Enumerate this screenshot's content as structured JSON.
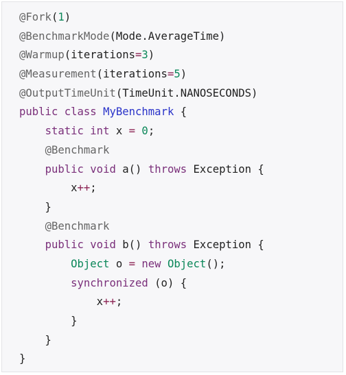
{
  "code_block": {
    "lines": [
      [
        {
          "t": "@Fork",
          "c": "ann"
        },
        {
          "t": "(",
          "c": "plain"
        },
        {
          "t": "1",
          "c": "num"
        },
        {
          "t": ")",
          "c": "plain"
        }
      ],
      [
        {
          "t": "@BenchmarkMode",
          "c": "ann"
        },
        {
          "t": "(Mode.AverageTime)",
          "c": "plain"
        }
      ],
      [
        {
          "t": "@Warmup",
          "c": "ann"
        },
        {
          "t": "(",
          "c": "plain"
        },
        {
          "t": "iterations",
          "c": "plain"
        },
        {
          "t": "=",
          "c": "op"
        },
        {
          "t": "3",
          "c": "num"
        },
        {
          "t": ")",
          "c": "plain"
        }
      ],
      [
        {
          "t": "@Measurement",
          "c": "ann"
        },
        {
          "t": "(",
          "c": "plain"
        },
        {
          "t": "iterations",
          "c": "plain"
        },
        {
          "t": "=",
          "c": "op"
        },
        {
          "t": "5",
          "c": "num"
        },
        {
          "t": ")",
          "c": "plain"
        }
      ],
      [
        {
          "t": "@OutputTimeUnit",
          "c": "ann"
        },
        {
          "t": "(TimeUnit.NANOSECONDS)",
          "c": "plain"
        }
      ],
      [
        {
          "t": "public",
          "c": "kw"
        },
        {
          "t": " ",
          "c": "plain"
        },
        {
          "t": "class",
          "c": "kw"
        },
        {
          "t": " ",
          "c": "plain"
        },
        {
          "t": "MyBenchmark",
          "c": "cls"
        },
        {
          "t": " {",
          "c": "plain"
        }
      ],
      [
        {
          "t": "    ",
          "c": "plain"
        },
        {
          "t": "static",
          "c": "kw"
        },
        {
          "t": " ",
          "c": "plain"
        },
        {
          "t": "int",
          "c": "kw"
        },
        {
          "t": " x ",
          "c": "plain"
        },
        {
          "t": "=",
          "c": "op"
        },
        {
          "t": " ",
          "c": "plain"
        },
        {
          "t": "0",
          "c": "num"
        },
        {
          "t": ";",
          "c": "plain"
        }
      ],
      [
        {
          "t": "    ",
          "c": "plain"
        },
        {
          "t": "@Benchmark",
          "c": "ann"
        }
      ],
      [
        {
          "t": "    ",
          "c": "plain"
        },
        {
          "t": "public",
          "c": "kw"
        },
        {
          "t": " ",
          "c": "plain"
        },
        {
          "t": "void",
          "c": "kw"
        },
        {
          "t": " a() ",
          "c": "plain"
        },
        {
          "t": "throws",
          "c": "kw"
        },
        {
          "t": " Exception {",
          "c": "plain"
        }
      ],
      [
        {
          "t": "        x",
          "c": "plain"
        },
        {
          "t": "++",
          "c": "op"
        },
        {
          "t": ";",
          "c": "plain"
        }
      ],
      [
        {
          "t": "    }",
          "c": "plain"
        }
      ],
      [
        {
          "t": "    ",
          "c": "plain"
        },
        {
          "t": "@Benchmark",
          "c": "ann"
        }
      ],
      [
        {
          "t": "    ",
          "c": "plain"
        },
        {
          "t": "public",
          "c": "kw"
        },
        {
          "t": " ",
          "c": "plain"
        },
        {
          "t": "void",
          "c": "kw"
        },
        {
          "t": " b() ",
          "c": "plain"
        },
        {
          "t": "throws",
          "c": "kw"
        },
        {
          "t": " Exception {",
          "c": "plain"
        }
      ],
      [
        {
          "t": "        ",
          "c": "plain"
        },
        {
          "t": "Object",
          "c": "num"
        },
        {
          "t": " o ",
          "c": "plain"
        },
        {
          "t": "=",
          "c": "op"
        },
        {
          "t": " ",
          "c": "plain"
        },
        {
          "t": "new",
          "c": "kw"
        },
        {
          "t": " ",
          "c": "plain"
        },
        {
          "t": "Object",
          "c": "num"
        },
        {
          "t": "();",
          "c": "plain"
        }
      ],
      [
        {
          "t": "        ",
          "c": "plain"
        },
        {
          "t": "synchronized",
          "c": "kw"
        },
        {
          "t": " (o) {",
          "c": "plain"
        }
      ],
      [
        {
          "t": "            x",
          "c": "plain"
        },
        {
          "t": "++",
          "c": "op"
        },
        {
          "t": ";",
          "c": "plain"
        }
      ],
      [
        {
          "t": "        }",
          "c": "plain"
        }
      ],
      [
        {
          "t": "    }",
          "c": "plain"
        }
      ],
      [
        {
          "t": "}",
          "c": "plain"
        }
      ]
    ]
  }
}
